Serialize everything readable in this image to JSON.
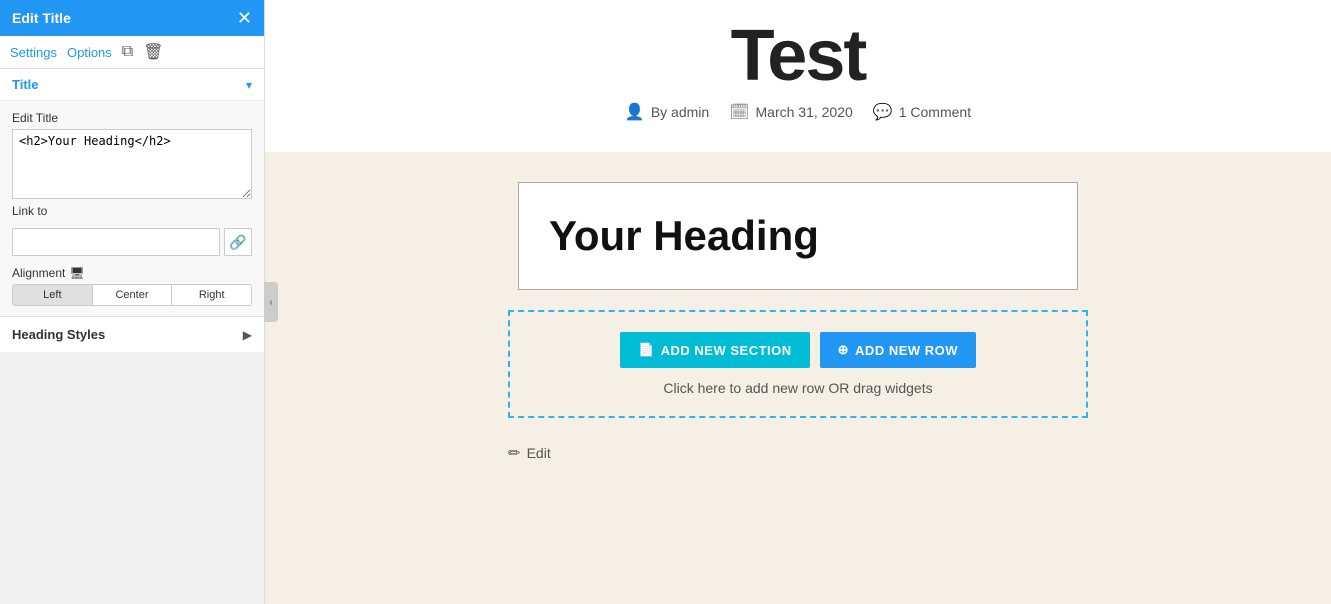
{
  "panel": {
    "title": "Edit Title",
    "close_icon": "✕",
    "tabs": {
      "settings_label": "Settings",
      "options_label": "Options",
      "copy_icon": "⧉",
      "trash_icon": "🗑"
    },
    "title_section": {
      "header": "Title",
      "collapse_arrow": "▾",
      "edit_title_label": "Edit Title",
      "textarea_value": "<h2>Your Heading</h2>",
      "link_label": "Link to",
      "link_placeholder": "",
      "link_icon": "🔗",
      "alignment_label": "Alignment",
      "monitor_icon": "🖥",
      "alignment_options": [
        "Left",
        "Center",
        "Right"
      ],
      "alignment_active": "Left"
    },
    "heading_styles": {
      "label": "Heading Styles",
      "arrow": "▶"
    }
  },
  "main": {
    "post_title": "Test",
    "meta": {
      "author_icon": "person",
      "author": "By admin",
      "calendar_icon": "calendar",
      "date": "March 31, 2020",
      "comment_icon": "comment",
      "comments": "1 Comment"
    },
    "heading_widget": {
      "text": "Your Heading"
    },
    "add_section": {
      "btn_section_label": "ADD NEW SECTION",
      "btn_section_icon": "📄",
      "btn_row_label": "ADD NEW ROW",
      "btn_row_icon": "⊕",
      "hint": "Click here to add new row OR drag widgets"
    },
    "edit_label": "Edit",
    "edit_icon": "✏"
  },
  "collapse_arrow": "‹"
}
